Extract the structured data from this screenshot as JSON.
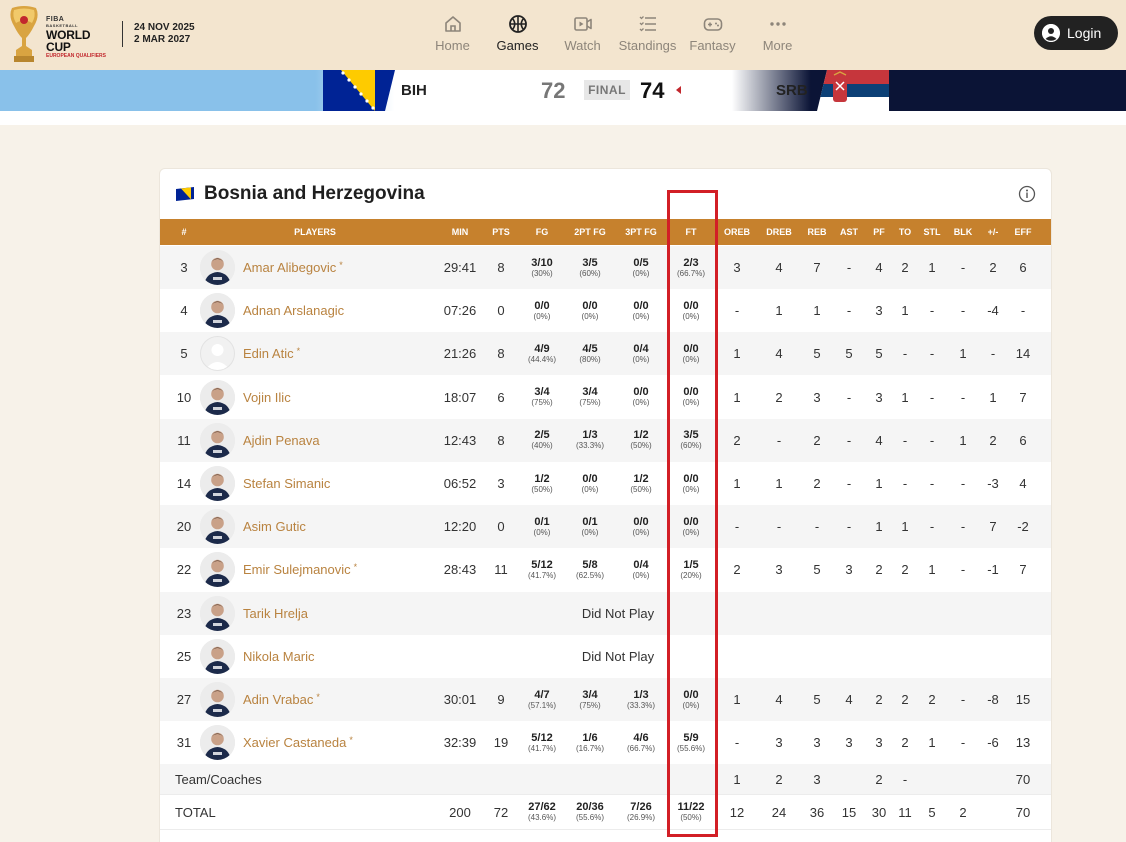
{
  "header": {
    "logo": {
      "fiba": "FIBA",
      "basketball": "BASKETBALL",
      "world_cup": "WORLD CUP",
      "qualifiers": "EUROPEAN QUALIFIERS"
    },
    "dates": [
      "24 NOV 2025",
      "2 MAR 2027"
    ],
    "nav": [
      {
        "label": "Home",
        "icon": "home-icon"
      },
      {
        "label": "Games",
        "icon": "basketball-icon",
        "active": true
      },
      {
        "label": "Watch",
        "icon": "video-icon"
      },
      {
        "label": "Standings",
        "icon": "list-icon"
      },
      {
        "label": "Fantasy",
        "icon": "gamepad-icon"
      },
      {
        "label": "More",
        "icon": "more-icon"
      }
    ],
    "login_label": "Login"
  },
  "scoreboard": {
    "home": {
      "abbr": "BIH",
      "score": "72"
    },
    "away": {
      "abbr": "SRB",
      "score": "74"
    },
    "status": "FINAL",
    "colors": {
      "bih_blue": "#002395",
      "bih_yellow": "#fecb00",
      "srb_red": "#c6363c",
      "srb_blue": "#0c4076"
    }
  },
  "boxscore": {
    "team_name": "Bosnia and Herzegovina",
    "columns": [
      "#",
      "PLAYERS",
      "MIN",
      "PTS",
      "FG",
      "2PT FG",
      "3PT FG",
      "FT",
      "OREB",
      "DREB",
      "REB",
      "AST",
      "PF",
      "TO",
      "STL",
      "BLK",
      "+/-",
      "EFF"
    ],
    "players": [
      {
        "no": "3",
        "name": "Amar Alibegovic",
        "starter": true,
        "min": "29:41",
        "pts": "8",
        "fg": [
          "3/10",
          "(30%)"
        ],
        "fg2": [
          "3/5",
          "(60%)"
        ],
        "fg3": [
          "0/5",
          "(0%)"
        ],
        "ft": [
          "2/3",
          "(66.7%)"
        ],
        "oreb": "3",
        "dreb": "4",
        "reb": "7",
        "ast": "-",
        "pf": "4",
        "to": "2",
        "stl": "1",
        "blk": "-",
        "pm": "2",
        "eff": "6"
      },
      {
        "no": "4",
        "name": "Adnan Arslanagic",
        "starter": false,
        "min": "07:26",
        "pts": "0",
        "fg": [
          "0/0",
          "(0%)"
        ],
        "fg2": [
          "0/0",
          "(0%)"
        ],
        "fg3": [
          "0/0",
          "(0%)"
        ],
        "ft": [
          "0/0",
          "(0%)"
        ],
        "oreb": "-",
        "dreb": "1",
        "reb": "1",
        "ast": "-",
        "pf": "3",
        "to": "1",
        "stl": "-",
        "blk": "-",
        "pm": "-4",
        "eff": "-"
      },
      {
        "no": "5",
        "name": "Edin Atic",
        "starter": true,
        "noPhoto": true,
        "min": "21:26",
        "pts": "8",
        "fg": [
          "4/9",
          "(44.4%)"
        ],
        "fg2": [
          "4/5",
          "(80%)"
        ],
        "fg3": [
          "0/4",
          "(0%)"
        ],
        "ft": [
          "0/0",
          "(0%)"
        ],
        "oreb": "1",
        "dreb": "4",
        "reb": "5",
        "ast": "5",
        "pf": "5",
        "to": "-",
        "stl": "-",
        "blk": "1",
        "pm": "-",
        "eff": "14"
      },
      {
        "no": "10",
        "name": "Vojin Ilic",
        "starter": false,
        "min": "18:07",
        "pts": "6",
        "fg": [
          "3/4",
          "(75%)"
        ],
        "fg2": [
          "3/4",
          "(75%)"
        ],
        "fg3": [
          "0/0",
          "(0%)"
        ],
        "ft": [
          "0/0",
          "(0%)"
        ],
        "oreb": "1",
        "dreb": "2",
        "reb": "3",
        "ast": "-",
        "pf": "3",
        "to": "1",
        "stl": "-",
        "blk": "-",
        "pm": "1",
        "eff": "7"
      },
      {
        "no": "11",
        "name": "Ajdin Penava",
        "starter": false,
        "min": "12:43",
        "pts": "8",
        "fg": [
          "2/5",
          "(40%)"
        ],
        "fg2": [
          "1/3",
          "(33.3%)"
        ],
        "fg3": [
          "1/2",
          "(50%)"
        ],
        "ft": [
          "3/5",
          "(60%)"
        ],
        "oreb": "2",
        "dreb": "-",
        "reb": "2",
        "ast": "-",
        "pf": "4",
        "to": "-",
        "stl": "-",
        "blk": "1",
        "pm": "2",
        "eff": "6"
      },
      {
        "no": "14",
        "name": "Stefan Simanic",
        "starter": false,
        "min": "06:52",
        "pts": "3",
        "fg": [
          "1/2",
          "(50%)"
        ],
        "fg2": [
          "0/0",
          "(0%)"
        ],
        "fg3": [
          "1/2",
          "(50%)"
        ],
        "ft": [
          "0/0",
          "(0%)"
        ],
        "oreb": "1",
        "dreb": "1",
        "reb": "2",
        "ast": "-",
        "pf": "1",
        "to": "-",
        "stl": "-",
        "blk": "-",
        "pm": "-3",
        "eff": "4"
      },
      {
        "no": "20",
        "name": "Asim Gutic",
        "starter": false,
        "min": "12:20",
        "pts": "0",
        "fg": [
          "0/1",
          "(0%)"
        ],
        "fg2": [
          "0/1",
          "(0%)"
        ],
        "fg3": [
          "0/0",
          "(0%)"
        ],
        "ft": [
          "0/0",
          "(0%)"
        ],
        "oreb": "-",
        "dreb": "-",
        "reb": "-",
        "ast": "-",
        "pf": "1",
        "to": "1",
        "stl": "-",
        "blk": "-",
        "pm": "7",
        "eff": "-2"
      },
      {
        "no": "22",
        "name": "Emir Sulejmanovic",
        "starter": true,
        "min": "28:43",
        "pts": "11",
        "fg": [
          "5/12",
          "(41.7%)"
        ],
        "fg2": [
          "5/8",
          "(62.5%)"
        ],
        "fg3": [
          "0/4",
          "(0%)"
        ],
        "ft": [
          "1/5",
          "(20%)"
        ],
        "oreb": "2",
        "dreb": "3",
        "reb": "5",
        "ast": "3",
        "pf": "2",
        "to": "2",
        "stl": "1",
        "blk": "-",
        "pm": "-1",
        "eff": "7"
      },
      {
        "no": "23",
        "name": "Tarik Hrelja",
        "starter": false,
        "dnp": "Did Not Play"
      },
      {
        "no": "25",
        "name": "Nikola Maric",
        "starter": false,
        "dnp": "Did Not Play"
      },
      {
        "no": "27",
        "name": "Adin Vrabac",
        "starter": true,
        "min": "30:01",
        "pts": "9",
        "fg": [
          "4/7",
          "(57.1%)"
        ],
        "fg2": [
          "3/4",
          "(75%)"
        ],
        "fg3": [
          "1/3",
          "(33.3%)"
        ],
        "ft": [
          "0/0",
          "(0%)"
        ],
        "oreb": "1",
        "dreb": "4",
        "reb": "5",
        "ast": "4",
        "pf": "2",
        "to": "2",
        "stl": "2",
        "blk": "-",
        "pm": "-8",
        "eff": "15"
      },
      {
        "no": "31",
        "name": "Xavier Castaneda",
        "starter": true,
        "min": "32:39",
        "pts": "19",
        "fg": [
          "5/12",
          "(41.7%)"
        ],
        "fg2": [
          "1/6",
          "(16.7%)"
        ],
        "fg3": [
          "4/6",
          "(66.7%)"
        ],
        "ft": [
          "5/9",
          "(55.6%)"
        ],
        "oreb": "-",
        "dreb": "3",
        "reb": "3",
        "ast": "3",
        "pf": "3",
        "to": "2",
        "stl": "1",
        "blk": "-",
        "pm": "-6",
        "eff": "13"
      }
    ],
    "team_coaches": {
      "label": "Team/Coaches",
      "oreb": "1",
      "dreb": "2",
      "reb": "3",
      "pf": "2",
      "to": "-",
      "eff": "70"
    },
    "total": {
      "label": "TOTAL",
      "min": "200",
      "pts": "72",
      "fg": [
        "27/62",
        "(43.6%)"
      ],
      "fg2": [
        "20/36",
        "(55.6%)"
      ],
      "fg3": [
        "7/26",
        "(26.9%)"
      ],
      "ft": [
        "11/22",
        "(50%)"
      ],
      "oreb": "12",
      "dreb": "24",
      "reb": "36",
      "ast": "15",
      "pf": "30",
      "to": "11",
      "stl": "5",
      "blk": "2",
      "eff": "70"
    },
    "starter_marker": "*",
    "header_color": "#c6812d",
    "name_color": "#b98340",
    "highlight_color": "#d21f26"
  }
}
